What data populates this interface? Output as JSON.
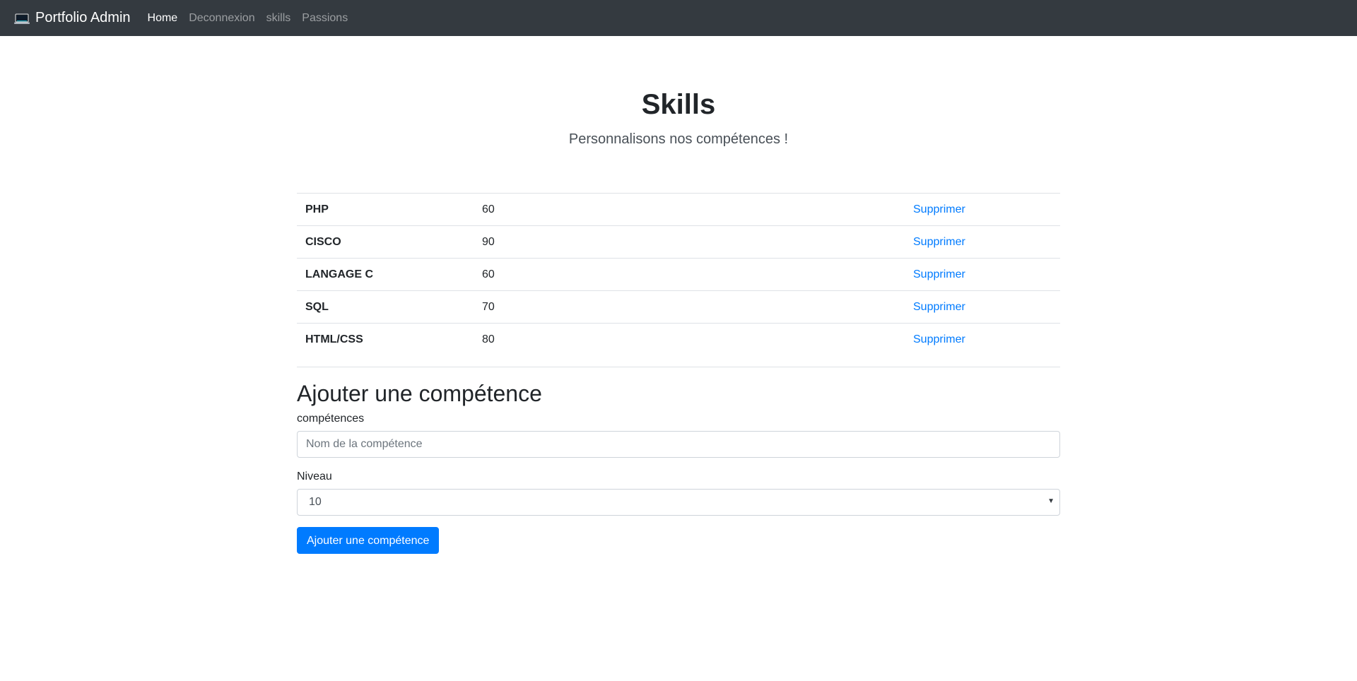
{
  "navbar": {
    "brand": "Portfolio Admin",
    "brand_icon": "laptop-icon",
    "links": [
      {
        "label": "Home",
        "active": true
      },
      {
        "label": "Deconnexion",
        "active": false
      },
      {
        "label": "skills",
        "active": false
      },
      {
        "label": "Passions",
        "active": false
      }
    ],
    "background": "#343a40"
  },
  "hero": {
    "title": "Skills",
    "subtitle": "Personnalisons nos compétences !"
  },
  "skills": [
    {
      "name": "PHP",
      "level": "60",
      "action": "Supprimer"
    },
    {
      "name": "CISCO",
      "level": "90",
      "action": "Supprimer"
    },
    {
      "name": "LANGAGE C",
      "level": "60",
      "action": "Supprimer"
    },
    {
      "name": "SQL",
      "level": "70",
      "action": "Supprimer"
    },
    {
      "name": "HTML/CSS",
      "level": "80",
      "action": "Supprimer"
    }
  ],
  "form": {
    "title": "Ajouter une compétence",
    "name_label": "compétences",
    "name_placeholder": "Nom de la compétence",
    "name_value": "",
    "level_label": "Niveau",
    "level_selected": "10",
    "submit_label": "Ajouter une compétence"
  },
  "colors": {
    "accent": "#007bff",
    "link": "#007bff",
    "navbar": "#343a40"
  }
}
